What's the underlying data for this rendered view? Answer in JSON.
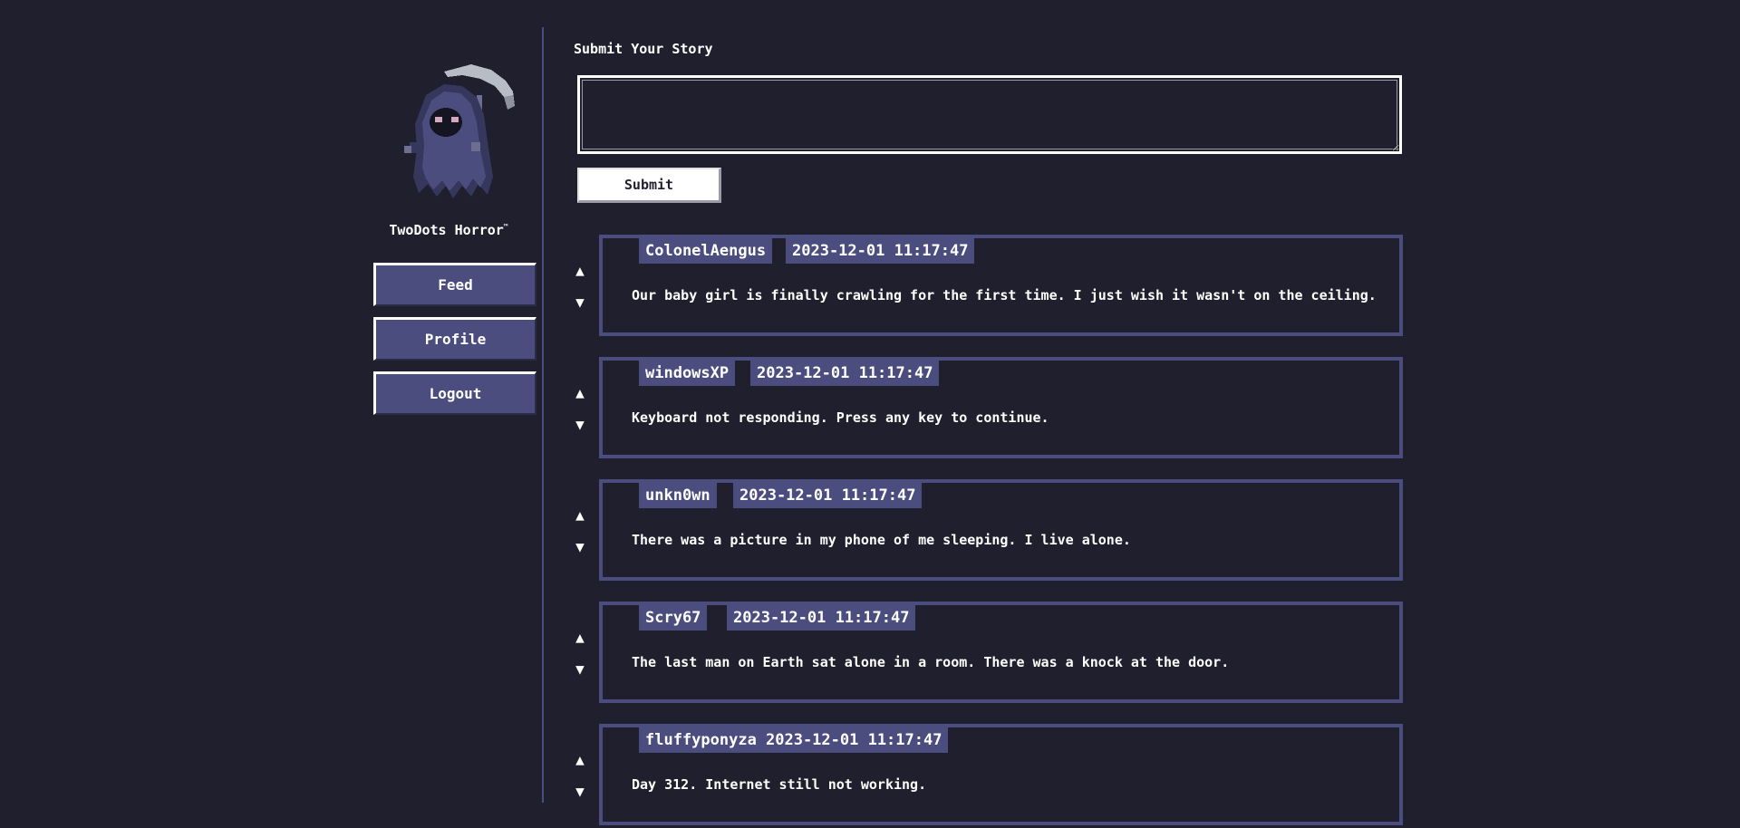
{
  "sidebar": {
    "site_name": "TwoDots Horror",
    "site_name_mark": "™",
    "nav": [
      {
        "label": "Feed"
      },
      {
        "label": "Profile"
      },
      {
        "label": "Logout"
      }
    ]
  },
  "form": {
    "title": "Submit Your Story",
    "input_value": "",
    "submit_label": "Submit"
  },
  "vote_icons": {
    "up": "▲",
    "down": "▼",
    "up_icon_name": "upvote-arrow-icon",
    "down_icon_name": "downvote-arrow-icon"
  },
  "posts": [
    {
      "author": "ColonelAengus",
      "timestamp": "2023-12-01 11:17:47",
      "text": "Our baby girl is finally crawling for the first time. I just wish it wasn't on the ceiling."
    },
    {
      "author": "windowsXP",
      "timestamp": "2023-12-01 11:17:47",
      "text": "Keyboard not responding. Press any key to continue."
    },
    {
      "author": "unkn0wn",
      "timestamp": "2023-12-01 11:17:47",
      "text": "There was a picture in my phone of me sleeping. I live alone."
    },
    {
      "author": "Scry67",
      "timestamp": "2023-12-01 11:17:47",
      "text": "The last man on Earth sat alone in a room. There was a knock at the door."
    },
    {
      "author": "fluffyponyza",
      "timestamp": "2023-12-01 11:17:47",
      "text": "Day 312. Internet still not working."
    }
  ],
  "colors": {
    "background": "#1f1f2e",
    "accent": "#4b4d7e",
    "text": "#ffffff"
  }
}
